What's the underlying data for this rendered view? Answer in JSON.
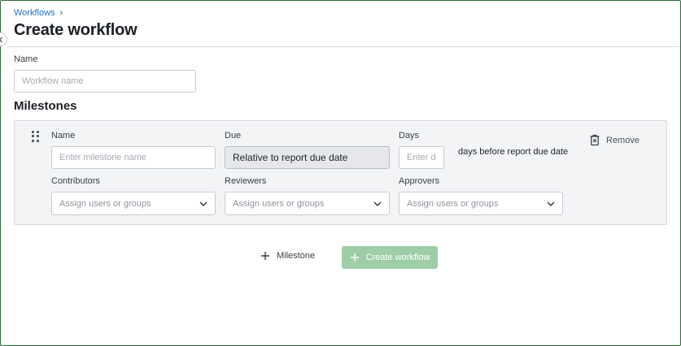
{
  "breadcrumb": {
    "parent": "Workflows",
    "separator": "›"
  },
  "page": {
    "title": "Create workflow"
  },
  "name_field": {
    "label": "Name",
    "placeholder": "Workflow name",
    "value": ""
  },
  "milestones": {
    "title": "Milestones",
    "items": [
      {
        "name_label": "Name",
        "name_placeholder": "Enter milestone name",
        "due_label": "Due",
        "due_value": "Relative to report due date",
        "days_label": "Days",
        "days_placeholder": "Enter da",
        "days_suffix": "days before report due date",
        "remove_label": "Remove",
        "contributors_label": "Contributors",
        "contributors_placeholder": "Assign users or groups",
        "reviewers_label": "Reviewers",
        "reviewers_placeholder": "Assign users or groups",
        "approvers_label": "Approvers",
        "approvers_placeholder": "Assign users or groups"
      }
    ]
  },
  "actions": {
    "add_milestone": "Milestone",
    "create_workflow": "Create workflow"
  },
  "icons": {
    "collapse": "chevron-left-icon",
    "breadcrumb_separator": "chevron-right-icon",
    "drag": "drag-handle-icon",
    "remove": "trash-icon",
    "dropdown": "chevron-down-icon",
    "add": "plus-icon"
  },
  "colors": {
    "link": "#1a73c8",
    "primary_disabled": "#9fcea6",
    "card_bg": "#f3f4f6"
  }
}
